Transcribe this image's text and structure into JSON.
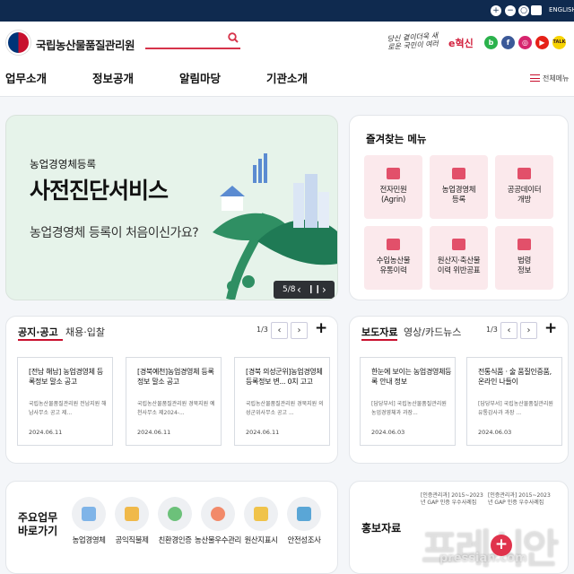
{
  "topbar": {
    "zoom_in": "+",
    "zoom_out": "−",
    "reset": "○",
    "print_icon": "print-icon",
    "lang": "ENGLISH"
  },
  "header": {
    "org_name": "국립농산물품질관리원",
    "slogan": "당신 곁이더욱 새로운 국민이 여러",
    "ehyuk": "e혁신",
    "sns": [
      {
        "name": "band",
        "label": "b",
        "color": "#2bb24c"
      },
      {
        "name": "facebook",
        "label": "f",
        "color": "#3b5998"
      },
      {
        "name": "instagram",
        "label": "◎",
        "color": "#d6246e"
      },
      {
        "name": "youtube",
        "label": "▶",
        "color": "#e62117"
      },
      {
        "name": "kakaotalk",
        "label": "TALK",
        "color": "#f7d300"
      }
    ]
  },
  "nav": {
    "items": [
      "업무소개",
      "정보공개",
      "알림마당",
      "기관소개"
    ],
    "all_menu": "전체메뉴"
  },
  "banner": {
    "subtitle": "농업경영체등록",
    "title": "사전진단서비스",
    "desc": "농업경영체 등록이 처음이신가요?",
    "counter": "5/8",
    "pause": "❙❙",
    "prev": "‹",
    "next": "›"
  },
  "favorites": {
    "title": "즐겨찾는 메뉴",
    "items": [
      "전자민원\n(Agrin)",
      "농업경영체\n등록",
      "공공데이터\n개방",
      "수입농산물\n유통이력",
      "원산지·축산물\n이력 위반공표",
      "법령\n정보"
    ]
  },
  "notice": {
    "tabs": [
      "공지·공고",
      "채용·입찰"
    ],
    "pager": "1/3",
    "prev": "‹",
    "next": "›",
    "more": "+",
    "posts": [
      {
        "title": "[전남 해남] 농업경영체 등록정보 말소 공고",
        "desc": "국립농산물품질관리원 전남지원 해남사무소 공고 제...",
        "date": "2024.06.11"
      },
      {
        "title": "[경북예천]농업경영체 등록정보 말소 공고",
        "desc": "국립농산물품질관리원 경북지원 예천사무소 제2024-...",
        "date": "2024.06.11"
      },
      {
        "title": "[경북 의성군위]농업경영체 등록정보 변... 0치 고고",
        "desc": "국립농산물품질관리원 경북지원 의성군위사무소 공고 ...",
        "date": "2024.06.11"
      }
    ]
  },
  "press": {
    "tabs": [
      "보도자료",
      "영상/카드뉴스"
    ],
    "pager": "1/3",
    "prev": "‹",
    "next": "›",
    "more": "+",
    "posts": [
      {
        "title": "한눈에 보이는 농업경영체등록 안내 정보",
        "desc": "[담당부서] 국립농산물품질관리원 농업경영체과 과장...",
        "date": "2024.06.03"
      },
      {
        "title": "전통식품 · 술 품질인증품, 온라인 나들이",
        "desc": "[담당부서] 국립농산물품질관리원 유통감사과 과장 ...",
        "date": "2024.06.03"
      }
    ]
  },
  "quick": {
    "label": "주요업무\n바로가기",
    "items": [
      {
        "label": "농업경영체",
        "color": "#7fb4e8"
      },
      {
        "label": "공익직불제",
        "color": "#f0b94a"
      },
      {
        "label": "친환경인증",
        "color": "#6cc17a"
      },
      {
        "label": "농산물우수관리",
        "color": "#f28a6a"
      },
      {
        "label": "원산지표시",
        "color": "#f0c34a"
      },
      {
        "label": "안전성조사",
        "color": "#5aa6d6"
      }
    ]
  },
  "pr": {
    "title": "홍보자료",
    "img1": "[인증관리과] 2015~2023년 GAP 인증 우수사례집",
    "img2": "[인증관리과] 2015~2023년 GAP 인증 우수사례집",
    "more": "+"
  },
  "watermark": {
    "main": "프레시안",
    "sub": "pressian.com"
  }
}
